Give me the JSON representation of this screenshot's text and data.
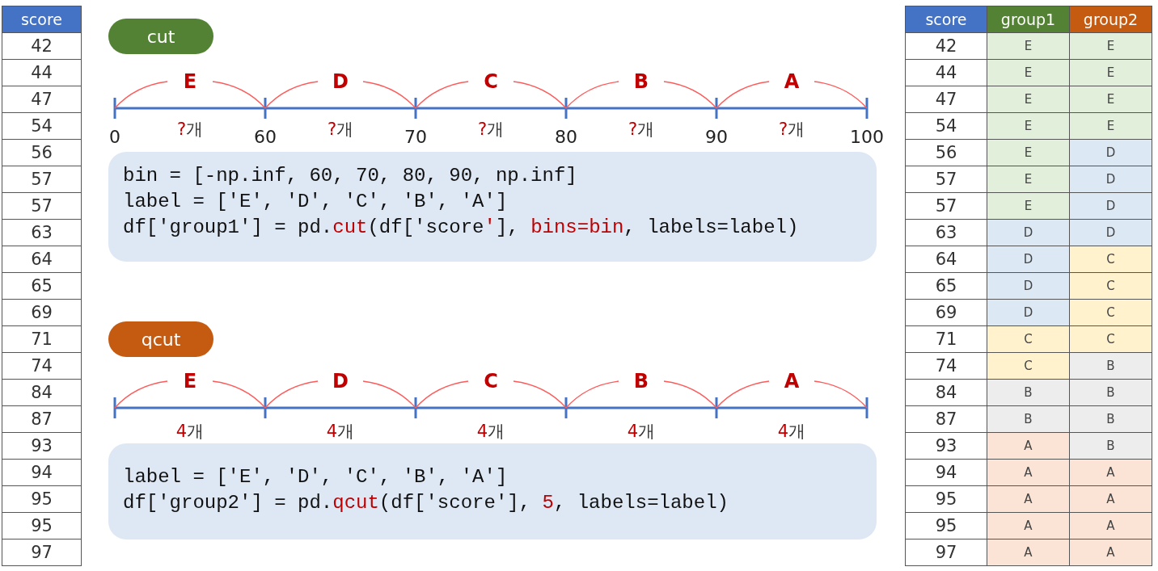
{
  "left_table": {
    "header": {
      "label": "score",
      "color": "#4472c4"
    },
    "rows": [
      "42",
      "44",
      "47",
      "54",
      "56",
      "57",
      "57",
      "63",
      "64",
      "65",
      "69",
      "71",
      "74",
      "84",
      "87",
      "93",
      "94",
      "95",
      "95",
      "97"
    ]
  },
  "sections": [
    {
      "pill": {
        "label": "cut",
        "color": "#548235"
      },
      "segments": [
        {
          "grade": "E",
          "mark": "?",
          "unit": "개"
        },
        {
          "grade": "D",
          "mark": "?",
          "unit": "개"
        },
        {
          "grade": "C",
          "mark": "?",
          "unit": "개"
        },
        {
          "grade": "B",
          "mark": "?",
          "unit": "개"
        },
        {
          "grade": "A",
          "mark": "?",
          "unit": "개"
        }
      ],
      "ticks": [
        "0",
        "60",
        "70",
        "80",
        "90",
        "100"
      ],
      "code": [
        [
          {
            "text": "bin = [-np.inf, 60, 70, 80, 90, np.inf]",
            "highlight": false
          }
        ],
        [
          {
            "text": "label = ['E', 'D', 'C', 'B', 'A']",
            "highlight": false
          }
        ],
        [
          {
            "text": "df['group1'] = pd.",
            "highlight": false
          },
          {
            "text": "cut",
            "highlight": true
          },
          {
            "text": "(df['score",
            "highlight": false
          },
          {
            "text": "'",
            "highlight": true
          },
          {
            "text": "], ",
            "highlight": false
          },
          {
            "text": "bins=bin",
            "highlight": true
          },
          {
            "text": ", labels=label)",
            "highlight": false
          }
        ]
      ]
    },
    {
      "pill": {
        "label": "qcut",
        "color": "#c55a11"
      },
      "segments": [
        {
          "grade": "E",
          "mark": "4",
          "unit": "개"
        },
        {
          "grade": "D",
          "mark": "4",
          "unit": "개"
        },
        {
          "grade": "C",
          "mark": "4",
          "unit": "개"
        },
        {
          "grade": "B",
          "mark": "4",
          "unit": "개"
        },
        {
          "grade": "A",
          "mark": "4",
          "unit": "개"
        }
      ],
      "code": [
        [
          {
            "text": "label = ['E', 'D', 'C', 'B', 'A']",
            "highlight": false
          }
        ],
        [
          {
            "text": "df['group2'] = pd.",
            "highlight": false
          },
          {
            "text": "qcut",
            "highlight": true
          },
          {
            "text": "(df['score'], ",
            "highlight": false
          },
          {
            "text": "5",
            "highlight": true
          },
          {
            "text": ", labels=label)",
            "highlight": false
          }
        ]
      ]
    }
  ],
  "right_table": {
    "columns": [
      {
        "label": "score",
        "color": "#4472c4"
      },
      {
        "label": "group1",
        "color": "#548235"
      },
      {
        "label": "group2",
        "color": "#c55a11"
      }
    ],
    "rows": [
      {
        "score": "42",
        "group1": {
          "text": "E",
          "color": "#e2efda"
        },
        "group2": {
          "text": "E",
          "color": "#e2efda"
        }
      },
      {
        "score": "44",
        "group1": {
          "text": "E",
          "color": "#e2efda"
        },
        "group2": {
          "text": "E",
          "color": "#e2efda"
        }
      },
      {
        "score": "47",
        "group1": {
          "text": "E",
          "color": "#e2efda"
        },
        "group2": {
          "text": "E",
          "color": "#e2efda"
        }
      },
      {
        "score": "54",
        "group1": {
          "text": "E",
          "color": "#e2efda"
        },
        "group2": {
          "text": "E",
          "color": "#e2efda"
        }
      },
      {
        "score": "56",
        "group1": {
          "text": "E",
          "color": "#e2efda"
        },
        "group2": {
          "text": "D",
          "color": "#dde8f5"
        }
      },
      {
        "score": "57",
        "group1": {
          "text": "E",
          "color": "#e2efda"
        },
        "group2": {
          "text": "D",
          "color": "#dde8f5"
        }
      },
      {
        "score": "57",
        "group1": {
          "text": "E",
          "color": "#e2efda"
        },
        "group2": {
          "text": "D",
          "color": "#dde8f5"
        }
      },
      {
        "score": "63",
        "group1": {
          "text": "D",
          "color": "#dde8f5"
        },
        "group2": {
          "text": "D",
          "color": "#dde8f5"
        }
      },
      {
        "score": "64",
        "group1": {
          "text": "D",
          "color": "#dde8f5"
        },
        "group2": {
          "text": "C",
          "color": "#fff2cc"
        }
      },
      {
        "score": "65",
        "group1": {
          "text": "D",
          "color": "#dde8f5"
        },
        "group2": {
          "text": "C",
          "color": "#fff2cc"
        }
      },
      {
        "score": "69",
        "group1": {
          "text": "D",
          "color": "#dde8f5"
        },
        "group2": {
          "text": "C",
          "color": "#fff2cc"
        }
      },
      {
        "score": "71",
        "group1": {
          "text": "C",
          "color": "#fff2cc"
        },
        "group2": {
          "text": "C",
          "color": "#fff2cc"
        }
      },
      {
        "score": "74",
        "group1": {
          "text": "C",
          "color": "#fff2cc"
        },
        "group2": {
          "text": "B",
          "color": "#ededed"
        }
      },
      {
        "score": "84",
        "group1": {
          "text": "B",
          "color": "#ededed"
        },
        "group2": {
          "text": "B",
          "color": "#ededed"
        }
      },
      {
        "score": "87",
        "group1": {
          "text": "B",
          "color": "#ededed"
        },
        "group2": {
          "text": "B",
          "color": "#ededed"
        }
      },
      {
        "score": "93",
        "group1": {
          "text": "A",
          "color": "#fbe4d5"
        },
        "group2": {
          "text": "B",
          "color": "#ededed"
        }
      },
      {
        "score": "94",
        "group1": {
          "text": "A",
          "color": "#fbe4d5"
        },
        "group2": {
          "text": "A",
          "color": "#fbe4d5"
        }
      },
      {
        "score": "95",
        "group1": {
          "text": "A",
          "color": "#fbe4d5"
        },
        "group2": {
          "text": "A",
          "color": "#fbe4d5"
        }
      },
      {
        "score": "95",
        "group1": {
          "text": "A",
          "color": "#fbe4d5"
        },
        "group2": {
          "text": "A",
          "color": "#fbe4d5"
        }
      },
      {
        "score": "97",
        "group1": {
          "text": "A",
          "color": "#fbe4d5"
        },
        "group2": {
          "text": "A",
          "color": "#fbe4d5"
        }
      }
    ]
  }
}
